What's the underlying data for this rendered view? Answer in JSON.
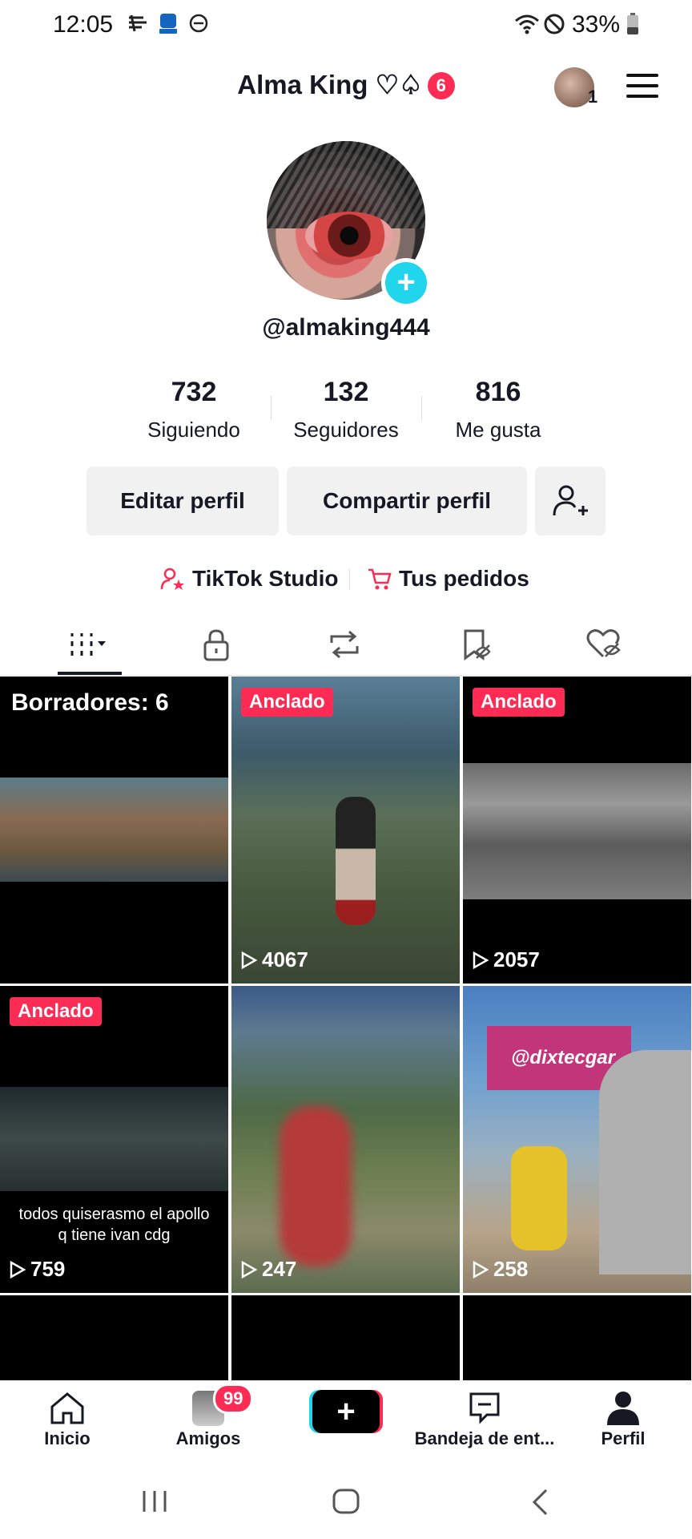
{
  "status_bar": {
    "time": "12:05",
    "battery": "33%"
  },
  "header": {
    "title": "Alma King ♡♤",
    "notification_count": "6",
    "friends_count": "1"
  },
  "profile": {
    "handle": "@almaking444",
    "stats": [
      {
        "value": "732",
        "label": "Siguiendo"
      },
      {
        "value": "132",
        "label": "Seguidores"
      },
      {
        "value": "816",
        "label": "Me gusta"
      }
    ],
    "edit_label": "Editar perfil",
    "share_label": "Compartir perfil",
    "studio_label": "TikTok Studio",
    "orders_label": "Tus pedidos"
  },
  "tabs": [
    "videos",
    "private",
    "reposts",
    "favorites",
    "liked"
  ],
  "grid": [
    {
      "type": "drafts",
      "label": "Borradores: 6"
    },
    {
      "type": "video",
      "pinned": "Anclado",
      "views": "4067"
    },
    {
      "type": "video",
      "pinned": "Anclado",
      "views": "2057"
    },
    {
      "type": "video",
      "pinned": "Anclado",
      "views": "759",
      "caption": "todos  quiserasmo  el apollo q tiene ivan cdg"
    },
    {
      "type": "video",
      "views": "247"
    },
    {
      "type": "video",
      "views": "258",
      "overlay": "@dixtecgar"
    }
  ],
  "bottom_nav": [
    {
      "label": "Inicio"
    },
    {
      "label": "Amigos",
      "badge": "99"
    },
    {
      "label": ""
    },
    {
      "label": "Bandeja de ent..."
    },
    {
      "label": "Perfil"
    }
  ],
  "colors": {
    "accent": "#fe2c55",
    "cyan": "#20d5ec"
  }
}
